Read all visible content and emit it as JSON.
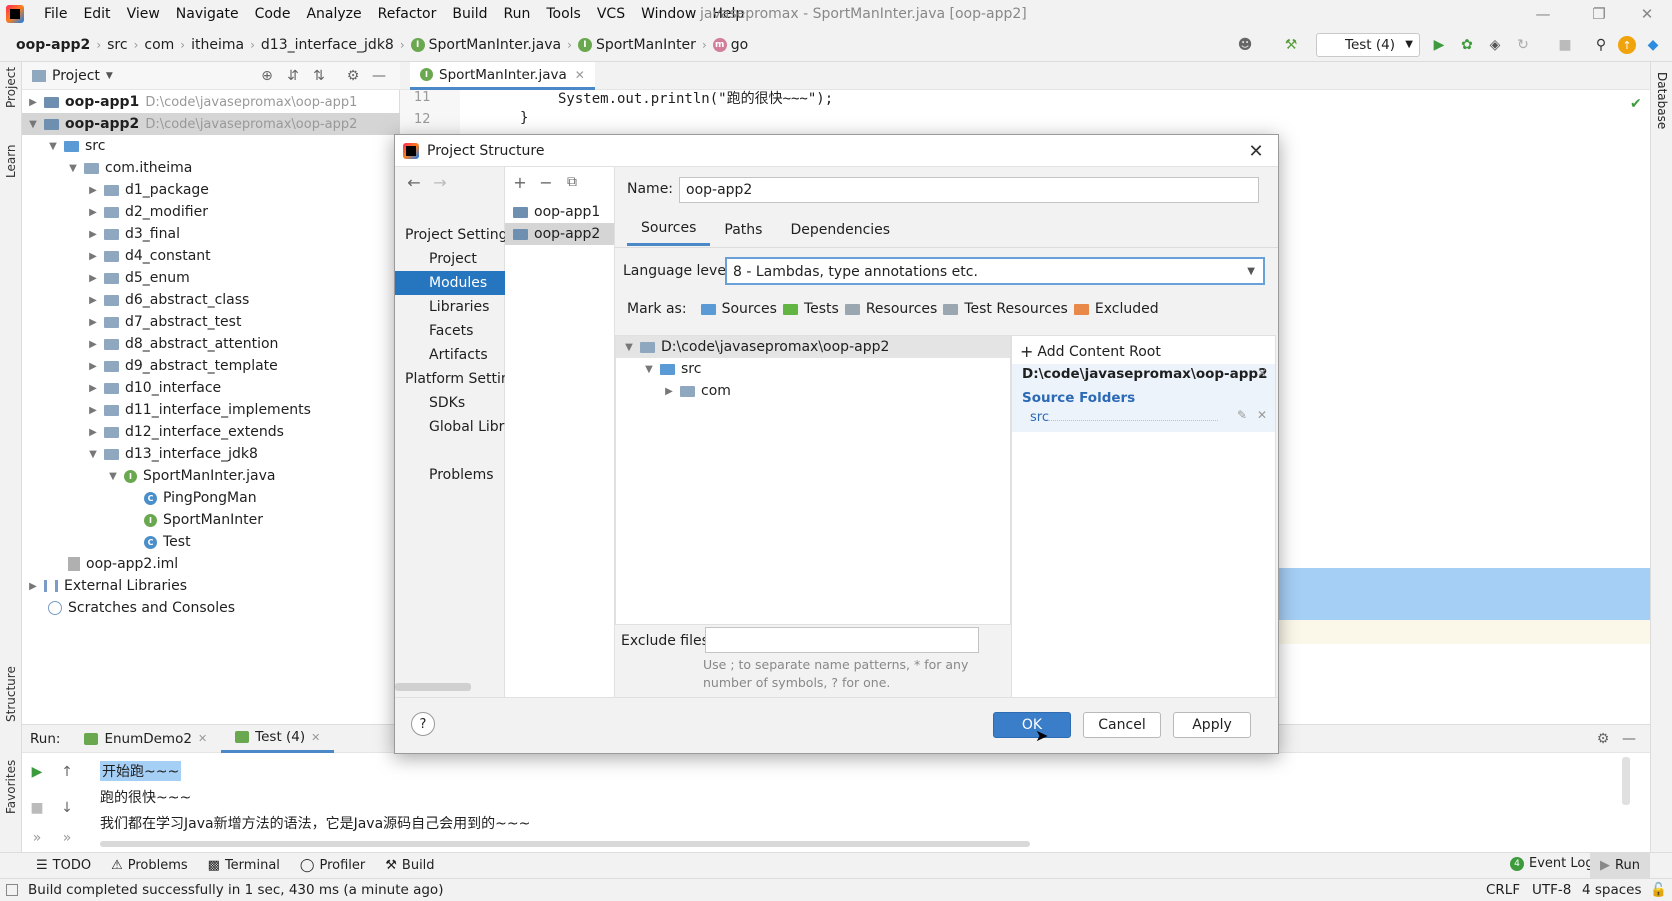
{
  "titlebar": {
    "menu": [
      "File",
      "Edit",
      "View",
      "Navigate",
      "Code",
      "Analyze",
      "Refactor",
      "Build",
      "Run",
      "Tools",
      "VCS",
      "Window",
      "Help"
    ],
    "window_title": "javasepromax - SportManInter.java [oop-app2]"
  },
  "navbar": {
    "crumbs": [
      "oop-app2",
      "src",
      "com",
      "itheima",
      "d13_interface_jdk8",
      "SportManInter.java",
      "SportManInter",
      "go"
    ],
    "run_config": "Test (4)"
  },
  "left_strip": {
    "project": "Project",
    "learn": "Learn",
    "structure": "Structure",
    "favorites": "Favorites"
  },
  "right_strip": {
    "database": "Database"
  },
  "project_panel": {
    "title": "Project",
    "items": [
      {
        "label": "oop-app1",
        "path": "D:\\code\\javasepromax\\oop-app1"
      },
      {
        "label": "oop-app2",
        "path": "D:\\code\\javasepromax\\oop-app2"
      },
      {
        "label": "src"
      },
      {
        "label": "com.itheima"
      },
      {
        "label": "d1_package"
      },
      {
        "label": "d2_modifier"
      },
      {
        "label": "d3_final"
      },
      {
        "label": "d4_constant"
      },
      {
        "label": "d5_enum"
      },
      {
        "label": "d6_abstract_class"
      },
      {
        "label": "d7_abstract_test"
      },
      {
        "label": "d8_abstract_attention"
      },
      {
        "label": "d9_abstract_template"
      },
      {
        "label": "d10_interface"
      },
      {
        "label": "d11_interface_implements"
      },
      {
        "label": "d12_interface_extends"
      },
      {
        "label": "d13_interface_jdk8"
      },
      {
        "label": "SportManInter.java"
      },
      {
        "label": "PingPongMan"
      },
      {
        "label": "SportManInter"
      },
      {
        "label": "Test"
      },
      {
        "label": "oop-app2.iml"
      },
      {
        "label": "External Libraries"
      },
      {
        "label": "Scratches and Consoles"
      }
    ]
  },
  "editor": {
    "tab": "SportManInter.java",
    "lines": [
      {
        "num": "11",
        "code": "System.out.println(\"跑的很快~~~\");"
      },
      {
        "num": "12",
        "code": "}"
      }
    ]
  },
  "dialog": {
    "title": "Project Structure",
    "categories": {
      "project_settings_header": "Project Settings",
      "project": "Project",
      "modules": "Modules",
      "libraries": "Libraries",
      "facets": "Facets",
      "artifacts": "Artifacts",
      "platform_settings_header": "Platform Settings",
      "sdks": "SDKs",
      "global_libraries": "Global Libraries",
      "problems": "Problems"
    },
    "modules": [
      "oop-app1",
      "oop-app2"
    ],
    "name_label": "Name:",
    "name_value": "oop-app2",
    "subtabs": [
      "Sources",
      "Paths",
      "Dependencies"
    ],
    "language_level_label": "Language level:",
    "language_level_value": "8 - Lambdas, type annotations etc.",
    "mark_as_label": "Mark as:",
    "mark_as": [
      "Sources",
      "Tests",
      "Resources",
      "Test Resources",
      "Excluded"
    ],
    "tree": {
      "root": "D:\\code\\javasepromax\\oop-app2",
      "src": "src",
      "com": "com"
    },
    "add_content_root": "Add Content Root",
    "content_root_path": "D:\\code\\javasepromax\\oop-app2",
    "source_folders_label": "Source Folders",
    "source_folder": "src",
    "exclude_files_label": "Exclude files:",
    "exclude_files_value": "",
    "exclude_hint_1": "Use ; to separate name patterns, * for any",
    "exclude_hint_2": "number of symbols, ? for one.",
    "ok": "OK",
    "cancel": "Cancel",
    "apply": "Apply",
    "help": "?"
  },
  "run_panel": {
    "label": "Run:",
    "tabs": [
      "EnumDemo2",
      "Test (4)"
    ],
    "output": [
      "开始跑~~~",
      "跑的很快~~~",
      "我们都在学习Java新增方法的语法，它是Java源码自己会用到的~~~"
    ]
  },
  "bottom_tools": {
    "items": [
      "TODO",
      "Problems",
      "Terminal",
      "Profiler",
      "Build"
    ],
    "event_log": "Event Log",
    "run": "Run",
    "event_log_count": "4"
  },
  "statusbar": {
    "message": "Build completed successfully in 1 sec, 430 ms (a minute ago)",
    "line_sep": "CRLF",
    "encoding": "UTF-8",
    "indent": "4 spaces"
  },
  "colors": {
    "accent": "#2675bf",
    "selection": "#a6cff5",
    "ok_button": "#3a7ec9"
  }
}
